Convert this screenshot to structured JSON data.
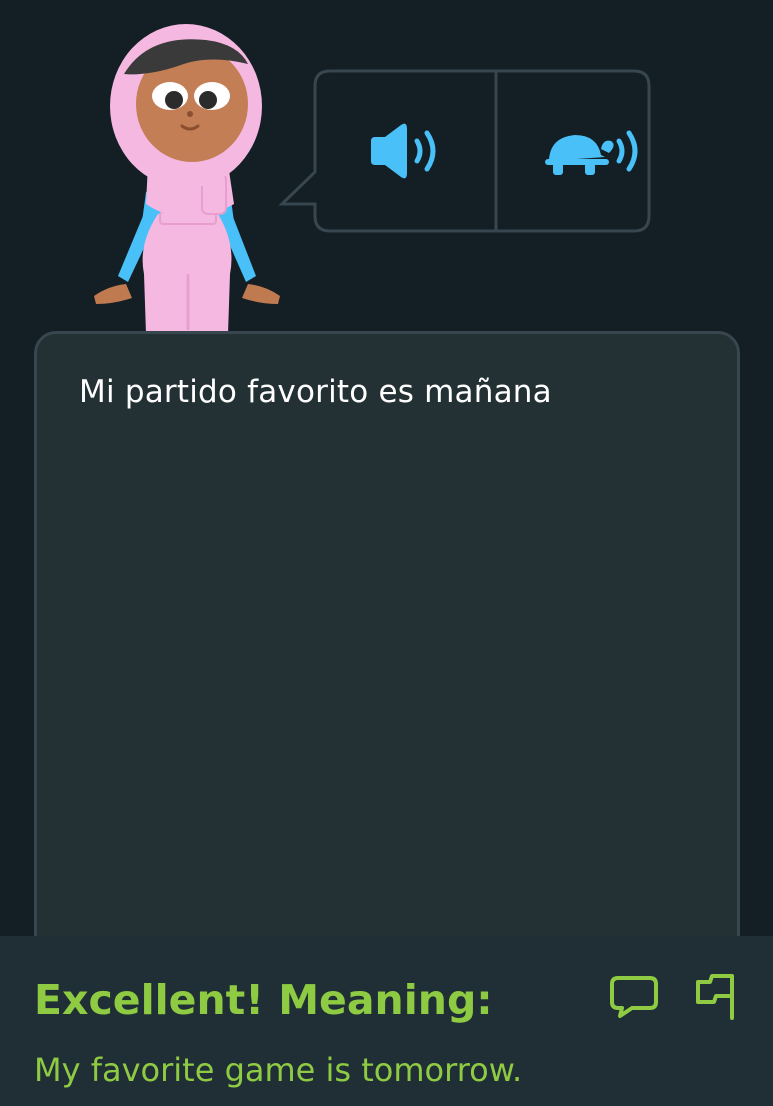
{
  "prompt": {
    "character": "pink-hijab-character",
    "audio_buttons": [
      {
        "icon": "speaker-icon",
        "name": "normal-speed"
      },
      {
        "icon": "turtle-speaker-icon",
        "name": "slow-speed"
      }
    ]
  },
  "answer": {
    "text": "Mi partido favorito es mañana"
  },
  "feedback": {
    "title": "Excellent! Meaning:",
    "meaning": "My favorite game is tomorrow.",
    "icons": [
      "comment-icon",
      "flag-icon"
    ]
  },
  "colors": {
    "background": "#131f24",
    "panel": "#233034",
    "panel_border": "#37464f",
    "feedback_bg": "#202f36",
    "accent_green": "#8ecb43",
    "audio_blue": "#49c0f8"
  }
}
